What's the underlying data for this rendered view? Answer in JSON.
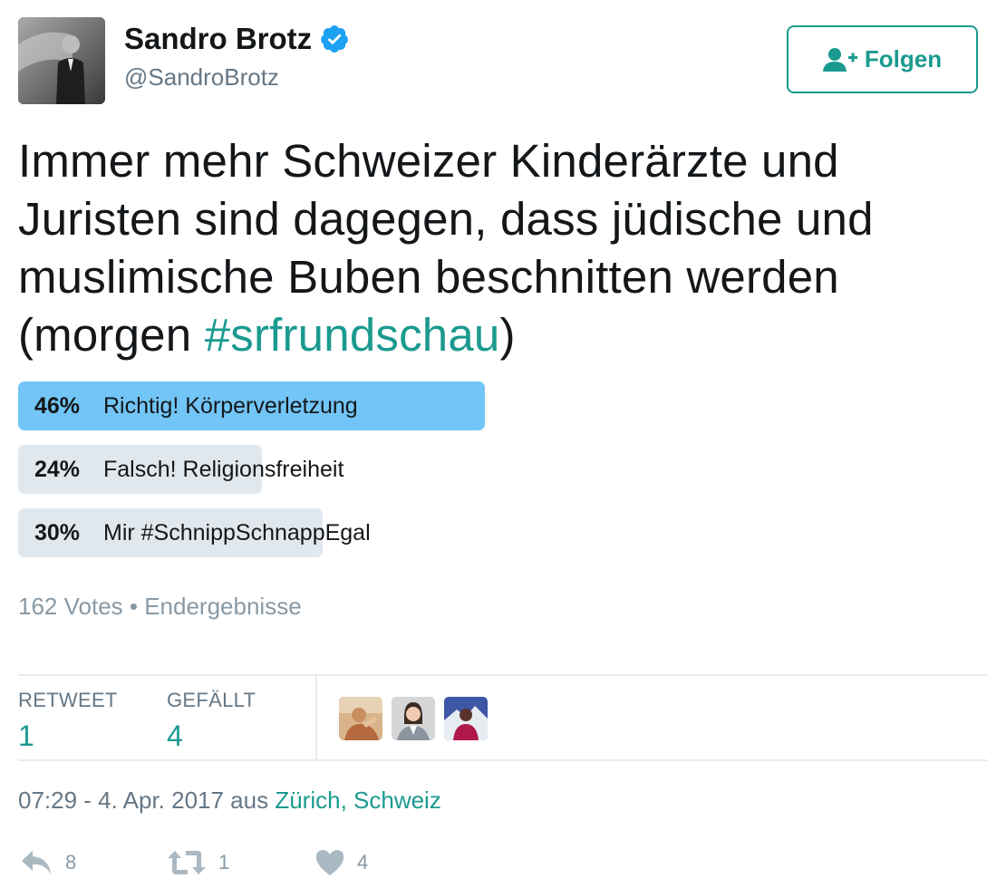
{
  "user": {
    "name": "Sandro Brotz",
    "handle": "@SandroBrotz",
    "verified": true
  },
  "follow_button": {
    "label": "Folgen",
    "icon": "user-plus-icon"
  },
  "tweet": {
    "text_before": "Immer mehr Schweizer Kinderärzte und Juristen sind dagegen, dass jüdische und muslimische Buben beschnitten werden (morgen ",
    "hashtag": "#srfrundschau",
    "text_after": ")"
  },
  "poll": {
    "choices": [
      {
        "percent": "46%",
        "label": "Richtig! Körperverletzung",
        "value": 46,
        "winner": true
      },
      {
        "percent": "24%",
        "label": "Falsch! Religionsfreiheit",
        "value": 24,
        "winner": false
      },
      {
        "percent": "30%",
        "label": "Mir #SchnippSchnappEgal",
        "value": 30,
        "winner": false
      }
    ],
    "meta": "162 Votes • Endergebnisse"
  },
  "stats": {
    "retweet_label": "RETWEET",
    "retweet_count": "1",
    "like_label": "GEFÄLLT",
    "like_count": "4"
  },
  "timestamp": {
    "time": "07:29 - 4. Apr. 2017 aus ",
    "location": "Zürich, Schweiz"
  },
  "actions": {
    "reply_count": "8",
    "retweet_count": "1",
    "like_count": "4"
  },
  "colors": {
    "accent": "#1b9a8f",
    "poll_winner": "#72c5f6",
    "poll_other": "#e1e8ed",
    "verified": "#1da1f2"
  }
}
